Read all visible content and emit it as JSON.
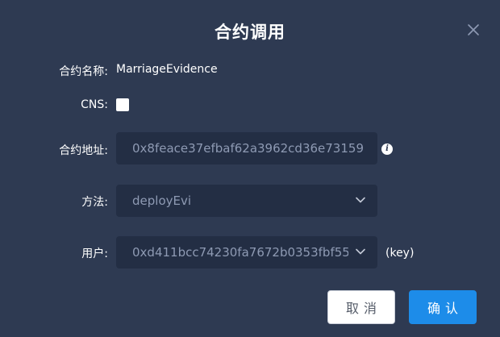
{
  "dialog": {
    "title": "合约调用",
    "close_icon": "close-icon"
  },
  "form": {
    "contract_name": {
      "label": "合约名称:",
      "value": "MarriageEvidence"
    },
    "cns": {
      "label": "CNS:",
      "checked": false
    },
    "contract_address": {
      "label": "合约地址:",
      "value": "0x8feace37efbaf62a3962cd36e73159",
      "info_icon": "info-icon",
      "info_glyph": "i"
    },
    "method": {
      "label": "方法:",
      "value": "deployEvi",
      "icon": "chevron-down-icon"
    },
    "user": {
      "label": "用户:",
      "value": "0xd411bcc74230fa7672b0353fbf55",
      "icon": "chevron-down-icon",
      "suffix": "(key)"
    }
  },
  "buttons": {
    "cancel_label": "取消",
    "confirm_label": "确认"
  },
  "colors": {
    "background": "#2e3a52",
    "field_background": "#232e44",
    "field_text": "#8e9ab3",
    "primary": "#1d8ce9"
  }
}
